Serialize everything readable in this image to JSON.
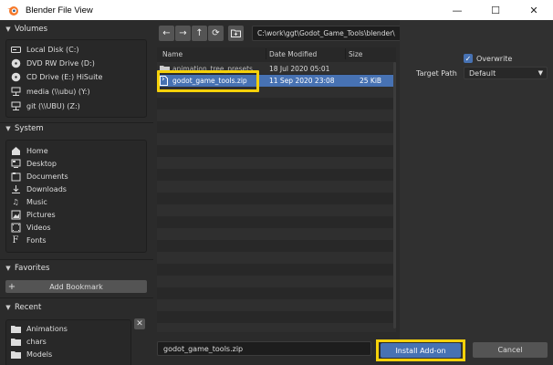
{
  "window": {
    "title": "Blender File View",
    "minimize_glyph": "—",
    "maximize_glyph": "☐",
    "close_glyph": "✕"
  },
  "sidebar": {
    "volumes": {
      "header": "Volumes",
      "items": [
        {
          "label": "Local Disk (C:)",
          "icon": "hard-disk-icon"
        },
        {
          "label": "DVD RW Drive (D:)",
          "icon": "disc-icon"
        },
        {
          "label": "CD Drive (E:) HiSuite",
          "icon": "disc-icon"
        },
        {
          "label": "media (\\\\ubu) (Y:)",
          "icon": "network-drive-icon"
        },
        {
          "label": "git (\\\\UBU) (Z:)",
          "icon": "network-drive-icon"
        }
      ]
    },
    "system": {
      "header": "System",
      "items": [
        {
          "label": "Home",
          "icon": "home-icon"
        },
        {
          "label": "Desktop",
          "icon": "desktop-icon"
        },
        {
          "label": "Documents",
          "icon": "documents-icon"
        },
        {
          "label": "Downloads",
          "icon": "download-icon"
        },
        {
          "label": "Music",
          "icon": "music-icon"
        },
        {
          "label": "Pictures",
          "icon": "pictures-icon"
        },
        {
          "label": "Videos",
          "icon": "videos-icon"
        },
        {
          "label": "Fonts",
          "icon": "fonts-icon"
        }
      ]
    },
    "favorites": {
      "header": "Favorites",
      "add_bookmark": "Add Bookmark"
    },
    "recent": {
      "header": "Recent",
      "items": [
        {
          "label": "Animations",
          "icon": "folder-icon"
        },
        {
          "label": "chars",
          "icon": "folder-icon"
        },
        {
          "label": "Models",
          "icon": "folder-icon"
        }
      ]
    }
  },
  "toolbar": {
    "path": "C:\\work\\ggt\\Godot_Game_Tools\\blender\\",
    "search_placeholder": ""
  },
  "filelist": {
    "columns": {
      "name": "Name",
      "date": "Date Modified",
      "size": "Size"
    },
    "rows": [
      {
        "name": "animation_tree_presets",
        "date": "18 Jul 2020 05:01",
        "size": "",
        "type": "folder",
        "selected": false
      },
      {
        "name": "godot_game_tools.zip",
        "date": "11 Sep 2020 23:08",
        "size": "25 KiB",
        "type": "file",
        "selected": true
      }
    ]
  },
  "options": {
    "overwrite_label": "Overwrite",
    "overwrite_checked": true,
    "target_path_label": "Target Path",
    "target_path_value": "Default"
  },
  "footer": {
    "filename": "godot_game_tools.zip",
    "install_label": "Install Add-on",
    "cancel_label": "Cancel"
  },
  "colors": {
    "accent": "#4772b3",
    "highlight": "#f5d10a",
    "background": "#303030"
  }
}
